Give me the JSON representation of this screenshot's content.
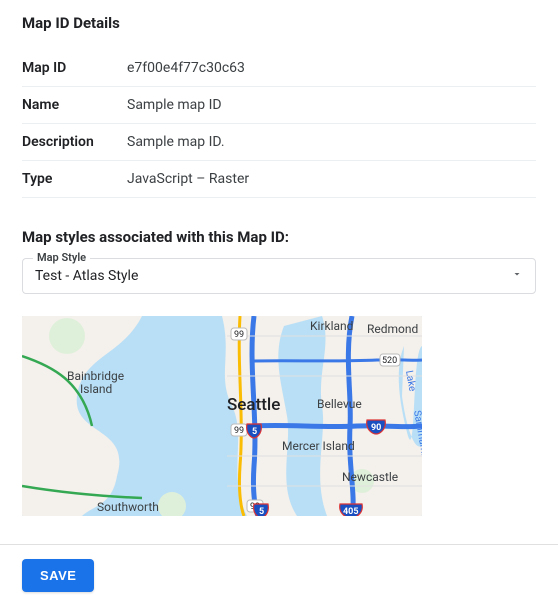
{
  "details": {
    "title": "Map ID Details",
    "rows": [
      {
        "label": "Map ID",
        "value": "e7f00e4f77c30c63"
      },
      {
        "label": "Name",
        "value": "Sample map ID"
      },
      {
        "label": "Description",
        "value": "Sample map ID."
      },
      {
        "label": "Type",
        "value": "JavaScript – Raster"
      }
    ]
  },
  "assoc": {
    "title": "Map styles associated with this Map ID:",
    "select_label": "Map Style",
    "selected": "Test - Atlas Style"
  },
  "map": {
    "labels": {
      "seattle": "Seattle",
      "bellevue": "Bellevue",
      "kirkland": "Kirkland",
      "redmond": "Redmond",
      "mercer": "Mercer Island",
      "newcastle": "Newcastle",
      "bainbridge1": "Bainbridge",
      "bainbridge2": "Island",
      "southworth": "Southworth"
    },
    "shields": {
      "r99a": "99",
      "r99b": "99",
      "r99c": "99",
      "r520": "520",
      "i5a": "5",
      "i5b": "5",
      "i90": "90",
      "i405": "405"
    }
  },
  "footer": {
    "save_label": "SAVE"
  }
}
